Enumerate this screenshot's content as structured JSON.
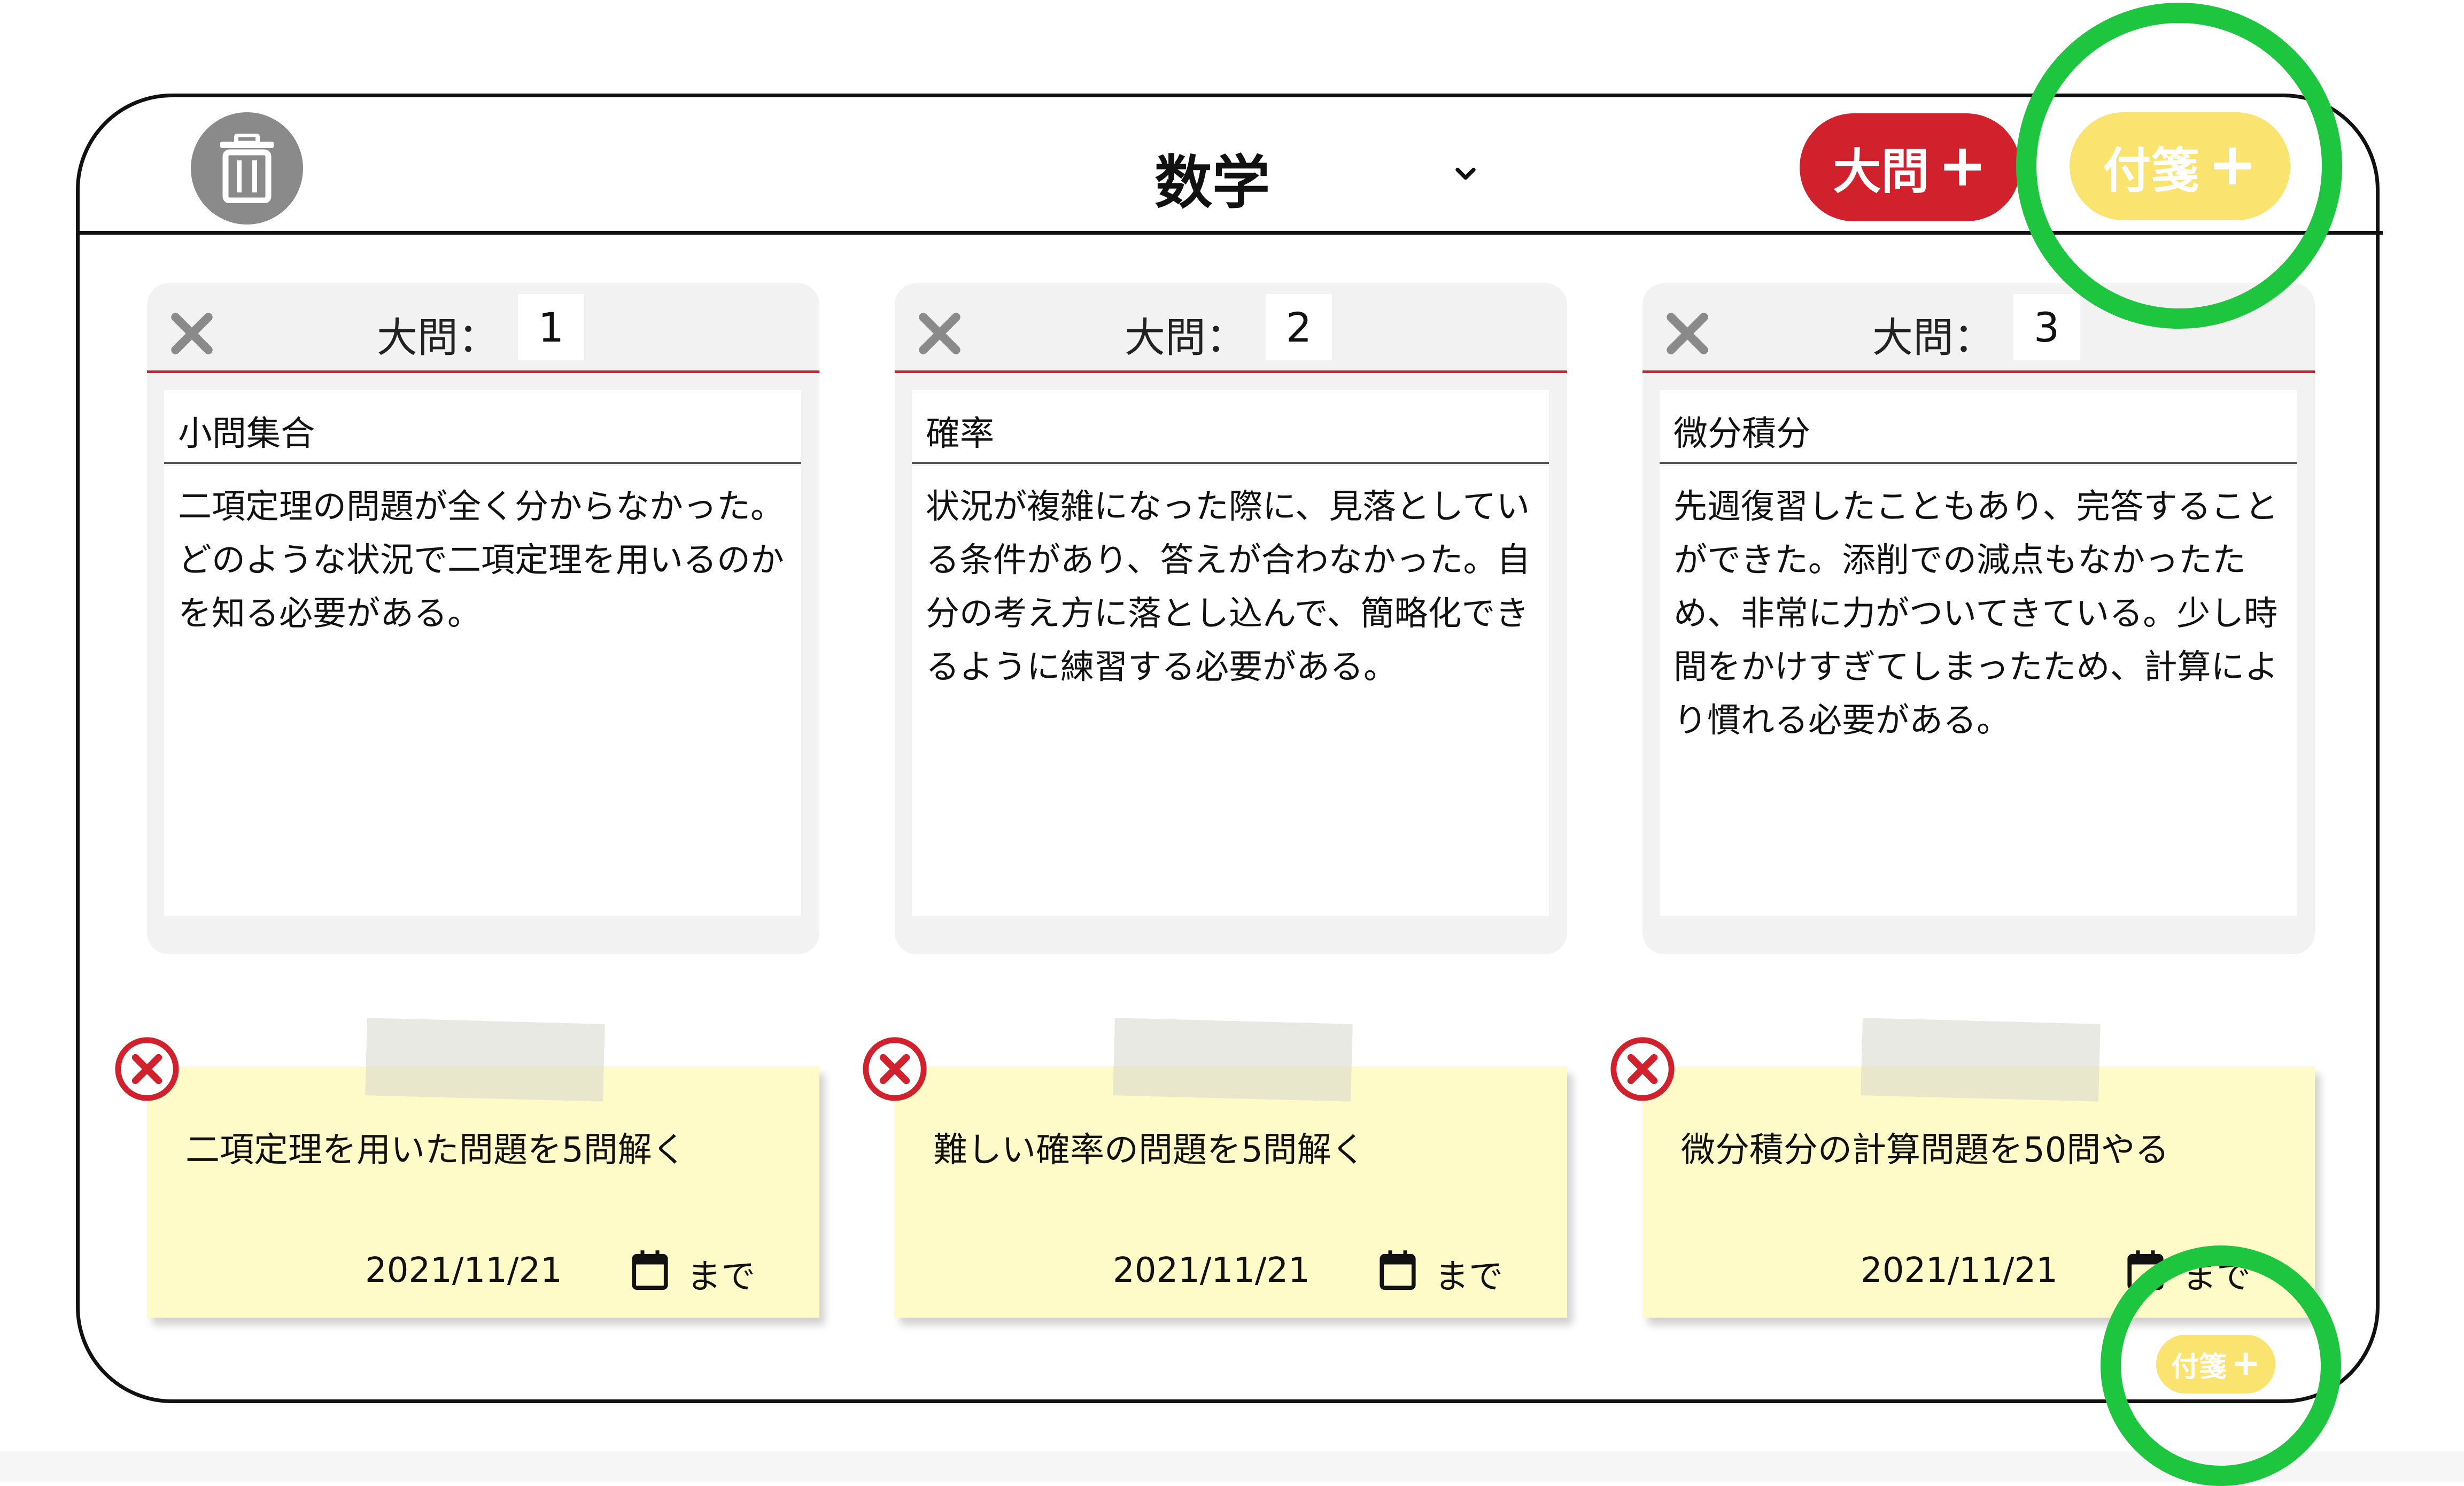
{
  "header": {
    "subject": "数学",
    "add_question_label": "大問",
    "add_note_label": "付箋",
    "plus": "+"
  },
  "question_label": "大問：",
  "questions": [
    {
      "number": "1",
      "topic": "小問集合",
      "body": "二項定理の問題が全く分からなかった。どのような状況で二項定理を用いるのかを知る必要がある。"
    },
    {
      "number": "2",
      "topic": "確率",
      "body": "状況が複雑になった際に、見落としている条件があり、答えが合わなかった。自分の考え方に落とし込んで、簡略化できるように練習する必要がある。"
    },
    {
      "number": "3",
      "topic": "微分積分",
      "body": "先週復習したこともあり、完答することができた。添削での減点もなかったため、非常に力がついてきている。少し時間をかけすぎてしまったため、計算により慣れる必要がある。"
    }
  ],
  "notes": [
    {
      "text": "二項定理を用いた問題を5問解く",
      "date": "2021/11/21",
      "until": "まで"
    },
    {
      "text": "難しい確率の問題を5問解く",
      "date": "2021/11/21",
      "until": "まで"
    },
    {
      "text": "微分積分の計算問題を50問やる",
      "date": "2021/11/21",
      "until": "まで"
    }
  ],
  "footer": {
    "add_note_label": "付箋",
    "plus": "+"
  },
  "colors": {
    "accent_red": "#d0212d",
    "note_yellow": "#fbe36f",
    "sticky_bg": "#fefbc8",
    "highlight_green": "#1ec63f",
    "trash_gray": "#8a8a8a"
  },
  "icons": {
    "trash": "trash-icon",
    "chevron": "chevron-down-icon",
    "card_close": "close-icon",
    "note_close": "close-circle-icon",
    "calendar": "calendar-icon"
  }
}
